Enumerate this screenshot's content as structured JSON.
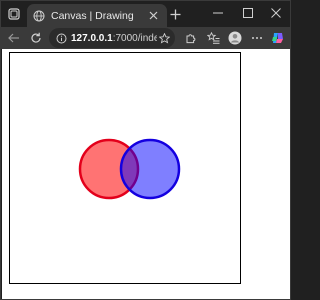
{
  "browser": {
    "tab": {
      "title": "Canvas | Drawing"
    },
    "address": {
      "host": "127.0.0.1",
      "rest": ":7000/index.h..."
    }
  },
  "drawing": {
    "circles": [
      {
        "name": "red-circle",
        "fill": "rgba(255,0,0,0.55)",
        "stroke": "#e3001b"
      },
      {
        "name": "blue-circle",
        "fill": "rgba(0,0,255,0.5)",
        "stroke": "#1400e0"
      }
    ]
  },
  "colors": {
    "chrome_bg": "#202020",
    "toolbar_bg": "#3a3a3a",
    "page_bg": "#ffffff"
  }
}
